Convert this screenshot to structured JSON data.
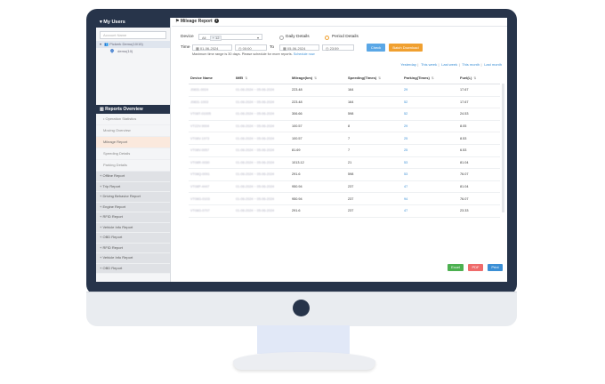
{
  "sidebar": {
    "title": "My Users",
    "search_placeholder": "Account Name",
    "tree": [
      {
        "label": "Pickerk Demo(10/15)",
        "selected": true
      },
      {
        "label": "demo(10)",
        "selected": false
      }
    ],
    "overview_title": "Reports Overview",
    "sub_items": [
      "Operation Statistics",
      "Moving Overview",
      "Mileage Report",
      "Speeding Details",
      "Parking Details"
    ],
    "active_sub": "Mileage Report",
    "categories": [
      "Offline Report",
      "Trip Report",
      "Driving Behavior Report",
      "Engine Report",
      "RFID Report",
      "Vehicle Info Report",
      "OBD Report",
      "RFID Report",
      "Vehicle Info Report",
      "OBD Report"
    ]
  },
  "main": {
    "title": "Mileage Report",
    "device_label": "Device",
    "device_value": "All",
    "device_count": "+ 12",
    "daily_label": "Daily Details",
    "period_label": "Period Details",
    "time_label": "Time",
    "start_date": "01-06-2024",
    "start_time": "00:00",
    "to_label": "To",
    "end_date": "05-06-2024",
    "end_time": "23:59",
    "check_label": "Check",
    "batch_label": "Batch Download",
    "note": "Maximum time range is 30 days. Please schedule for more reports.",
    "schedule_link": "Schedule now",
    "quick": [
      "Yesterday",
      "This week",
      "Last week",
      "This month",
      "Last month"
    ]
  },
  "table": {
    "headers": [
      "Device Name",
      "IMEI",
      "Mileage(km)",
      "Speeding(Times)",
      "Parking(Times)",
      "Fuel(L)"
    ],
    "rows": [
      [
        "J0831-0024",
        "01-06-2024 ~ 05-06-2024",
        "223.48",
        "164",
        "29",
        "17.67"
      ],
      [
        "J0831-1003",
        "01-06-2024 ~ 05-06-2024",
        "223.48",
        "164",
        "52",
        "17.67"
      ],
      [
        "VT08T-01005",
        "01-06-2024 ~ 05-06-2024",
        "306.66",
        "598",
        "52",
        "24.53"
      ],
      [
        "VT22V-9004",
        "01-06-2024 ~ 05-06-2024",
        "100.57",
        "8",
        "29",
        "8.05"
      ],
      [
        "VT08V-1973",
        "01-06-2024 ~ 05-06-2024",
        "100.57",
        "7",
        "25",
        "8.53"
      ],
      [
        "VT08V-0057",
        "01-06-2024 ~ 05-06-2024",
        "81.69",
        "7",
        "25",
        "6.53"
      ],
      [
        "VT08R-0030",
        "01-06-2024 ~ 05-06-2024",
        "1013.12",
        "21",
        "53",
        "81.04"
      ],
      [
        "VT08Q-0091",
        "01-06-2024 ~ 05-06-2024",
        "291.6",
        "598",
        "53",
        "76.07"
      ],
      [
        "VT08P-4447",
        "01-06-2024 ~ 05-06-2024",
        "950.94",
        "237",
        "47",
        "81.04"
      ],
      [
        "VT08G-0103",
        "01-06-2024 ~ 05-06-2024",
        "950.94",
        "237",
        "94",
        "76.07"
      ],
      [
        "VT08G-0707",
        "01-06-2024 ~ 05-06-2024",
        "291.6",
        "237",
        "47",
        "23.33"
      ]
    ]
  },
  "export": {
    "excel": "Excel",
    "pdf": "PDF",
    "print": "Print"
  },
  "colors": {
    "navy": "#27344a",
    "accent_blue": "#3b8fd5",
    "orange": "#f0a030",
    "excel": "#4cb050",
    "pdf": "#ef6b6b",
    "print": "#3b8fd5"
  }
}
